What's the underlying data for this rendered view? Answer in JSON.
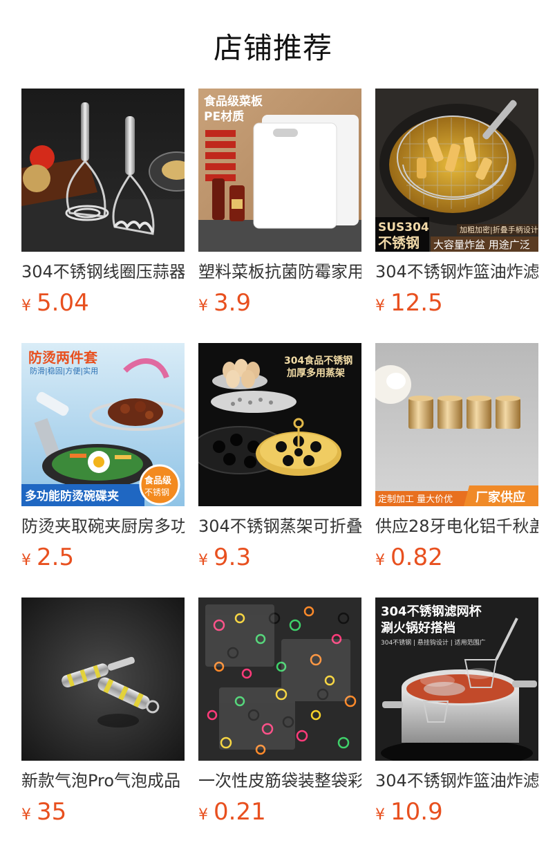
{
  "page": {
    "title": "店铺推荐"
  },
  "currency_symbol": "¥",
  "products": [
    {
      "title": "304不锈钢线圈压蒜器",
      "price": "5.04",
      "image_text": []
    },
    {
      "title": "塑料菜板抗菌防霉家用",
      "price": "3.9",
      "image_text": [
        "食品级菜板",
        "PE材质"
      ]
    },
    {
      "title": "304不锈钢炸篮油炸滤",
      "price": "12.5",
      "image_text": [
        "SUS304",
        "不锈钢",
        "加粗加密|折叠手柄设计",
        "大容量炸盆 用途广泛"
      ]
    },
    {
      "title": "防烫夹取碗夹厨房多功",
      "price": "2.5",
      "image_text": [
        "防烫两件套",
        "防滑|稳固|方便|实用",
        "多功能防烫碗碟夹",
        "食品级",
        "不锈钢"
      ]
    },
    {
      "title": "304不锈钢蒸架可折叠",
      "price": "9.3",
      "image_text": [
        "304食品不锈钢",
        "加厚多用蒸架"
      ]
    },
    {
      "title": "供应28牙电化铝千秋盖",
      "price": "0.82",
      "image_text": [
        "定制加工 量大价优",
        "厂家供应"
      ]
    },
    {
      "title": "新款气泡Pro气泡成品",
      "price": "35",
      "image_text": []
    },
    {
      "title": "一次性皮筋袋装整袋彩",
      "price": "0.21",
      "image_text": []
    },
    {
      "title": "304不锈钢炸篮油炸滤",
      "price": "10.9",
      "image_text": [
        "304不锈钢滤网杯",
        "涮火锅好搭档",
        "304不锈钢 | 悬挂钩设计 | 适用范围广"
      ]
    }
  ]
}
